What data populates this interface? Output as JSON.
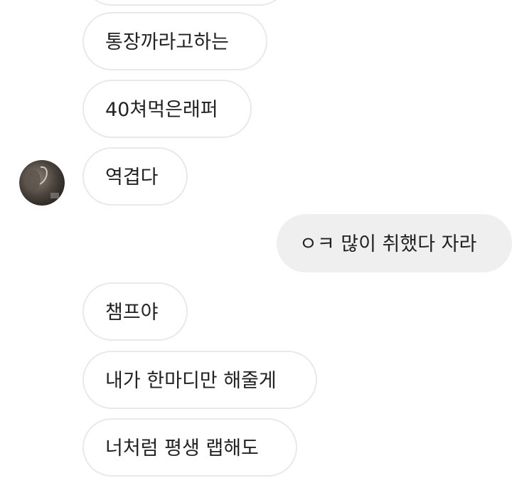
{
  "messages": [
    {
      "sender": "them",
      "text": ""
    },
    {
      "sender": "them",
      "text": "통장까라고하는"
    },
    {
      "sender": "them",
      "text": "40쳐먹은래퍼"
    },
    {
      "sender": "them",
      "text": "역겹다"
    },
    {
      "sender": "me",
      "text": "ㅇㅋ 많이 취했다 자라"
    },
    {
      "sender": "them",
      "text": "챔프야"
    },
    {
      "sender": "them",
      "text": "내가 한마디만 해줄게"
    },
    {
      "sender": "them",
      "text": "너처럼 평생 랩해도"
    }
  ],
  "colors": {
    "incoming_bubble": "#ffffff",
    "incoming_border": "#e9e9e9",
    "outgoing_bubble": "#efefef",
    "text": "#222222"
  },
  "icons": {
    "avatar": "profile-avatar-icon"
  }
}
